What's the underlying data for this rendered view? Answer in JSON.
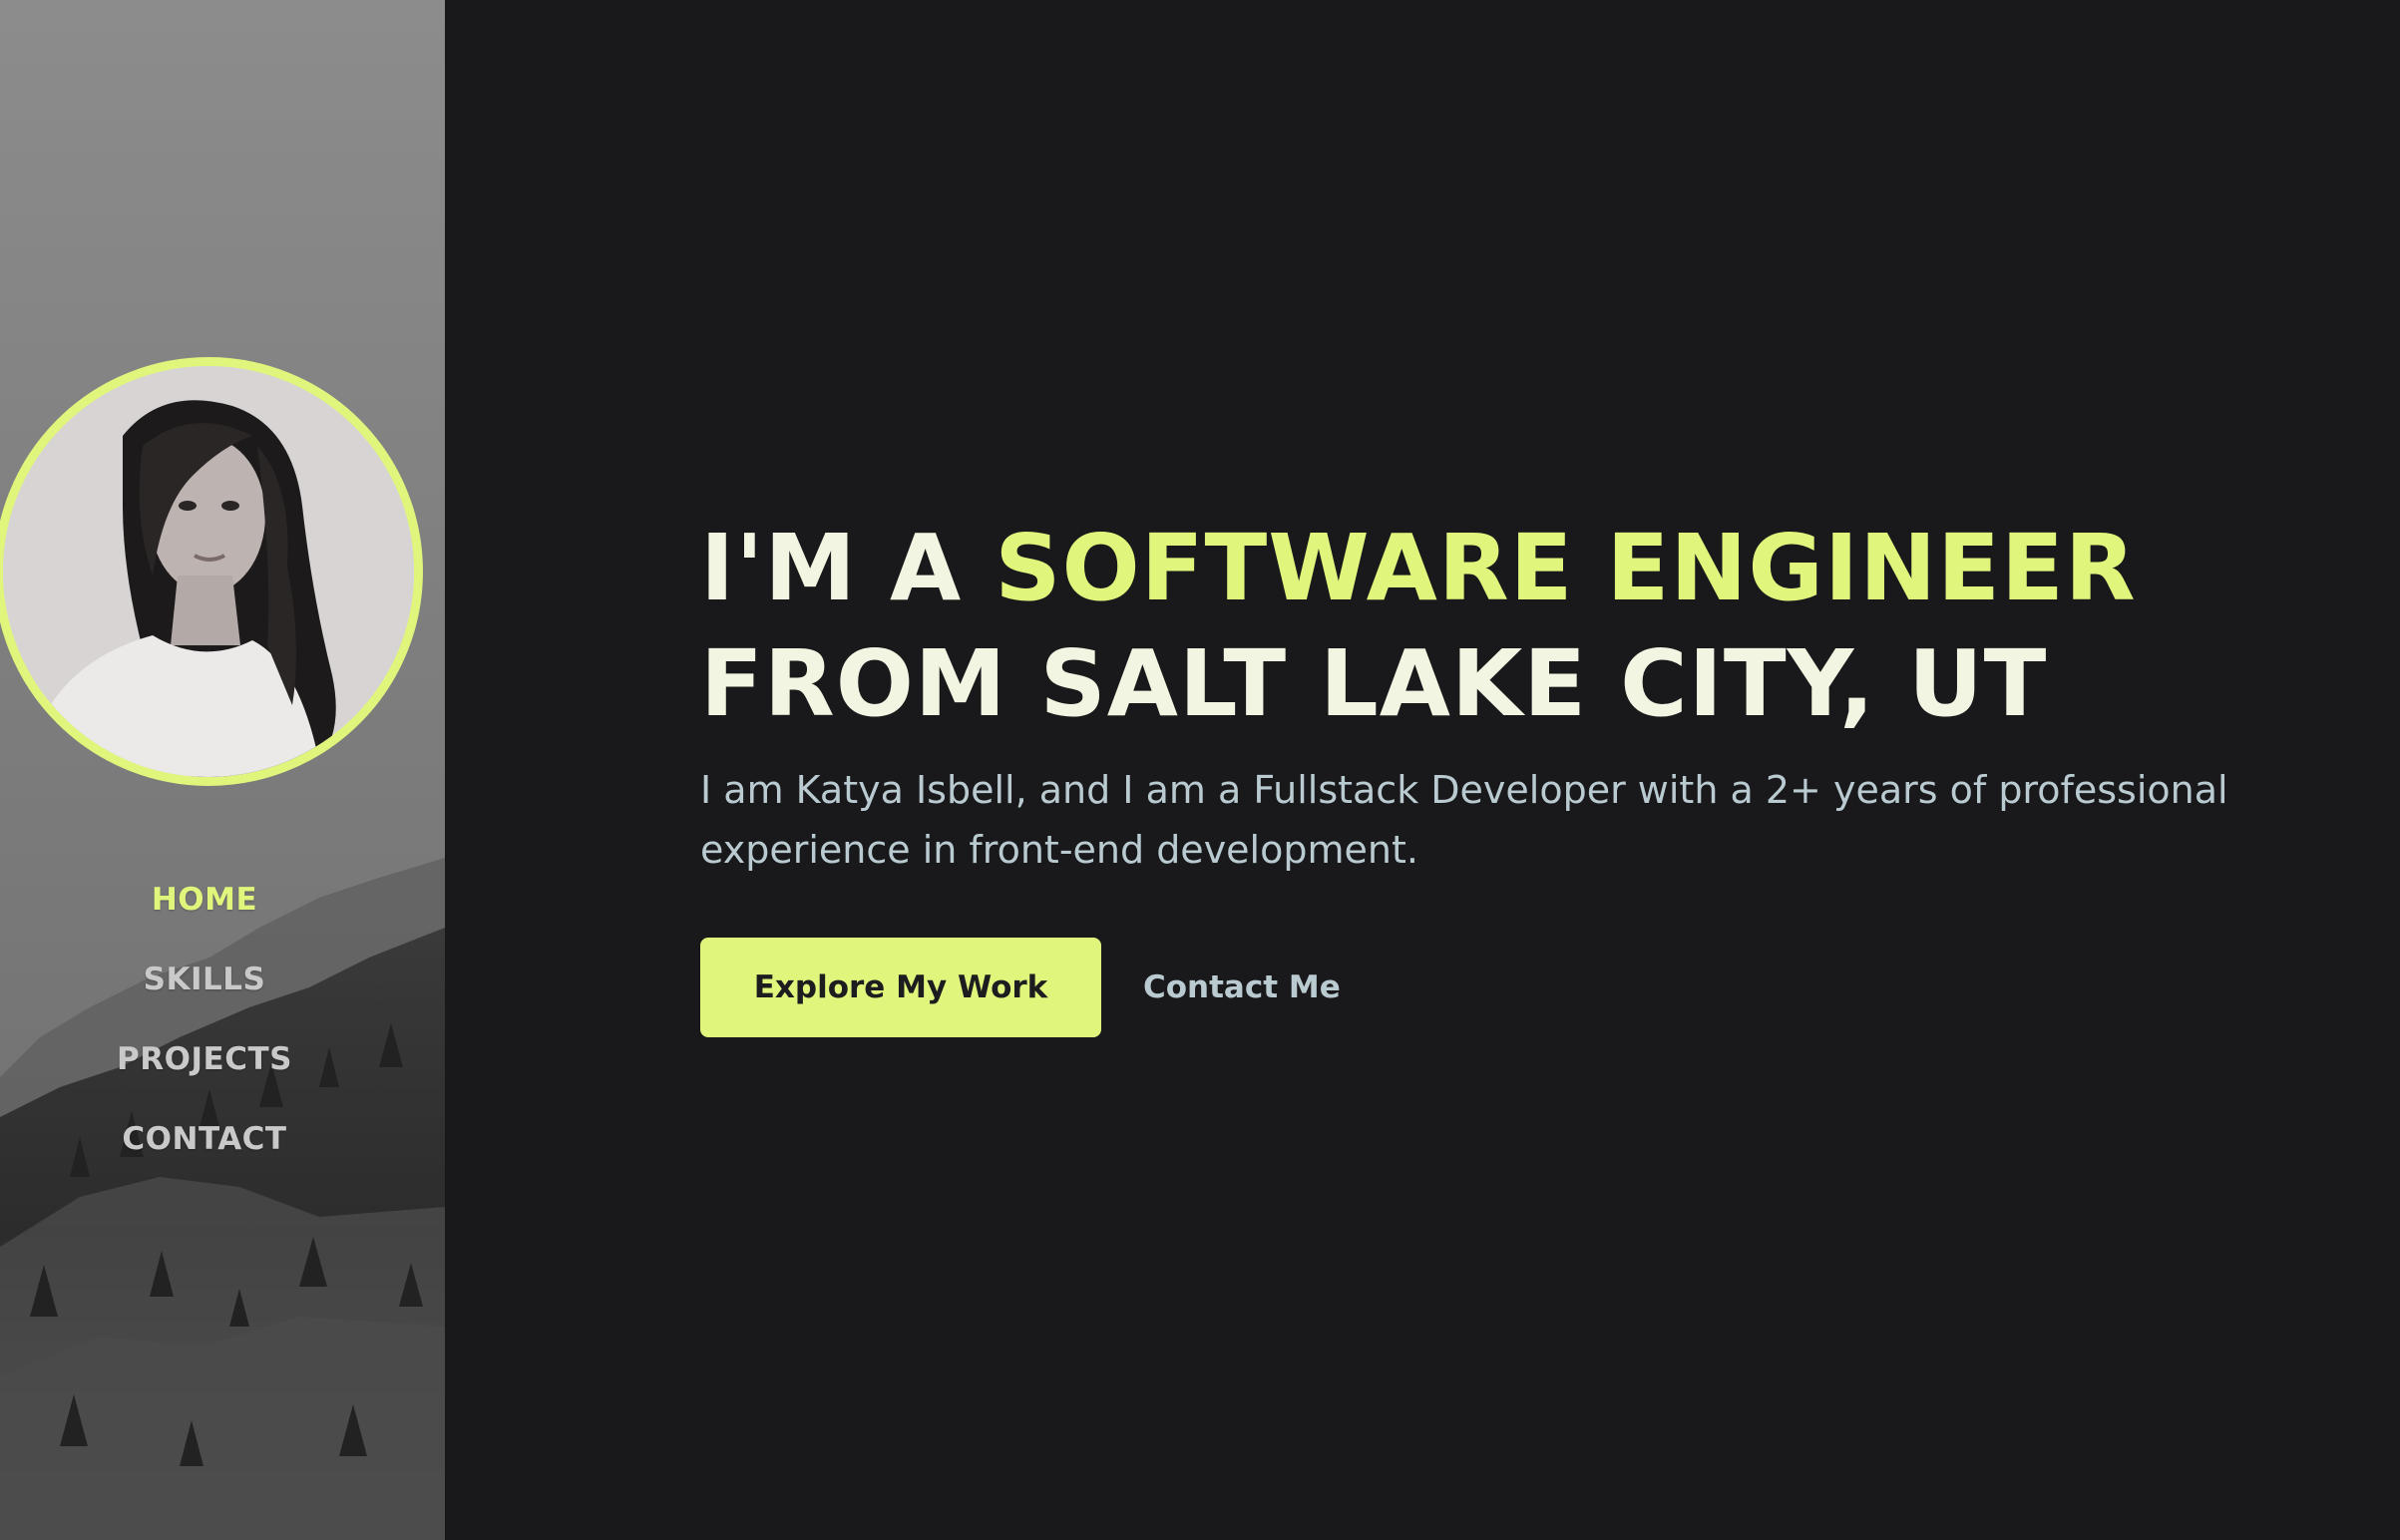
{
  "colors": {
    "accent": "#dff57c",
    "background": "#19191c",
    "heading": "#f2f5e1",
    "body_text": "#b9cbd0",
    "nav_inactive": "#c9c9c9"
  },
  "sidebar": {
    "avatar_alt": "profile-photo",
    "nav": [
      {
        "label": "HOME",
        "active": true
      },
      {
        "label": "SKILLS",
        "active": false
      },
      {
        "label": "PROJECTS",
        "active": false
      },
      {
        "label": "CONTACT",
        "active": false
      }
    ]
  },
  "hero": {
    "headline_prefix": "I'M A ",
    "headline_accent": "SOFTWARE ENGINEER",
    "headline_line2": "FROM SALT LAKE CITY, UT",
    "intro": "I am Katya Isbell, and I am a Fullstack Developer with a 2+ years of professional experience in front-end development.",
    "primary_button": "Explore My Work",
    "secondary_link": "Contact Me"
  }
}
